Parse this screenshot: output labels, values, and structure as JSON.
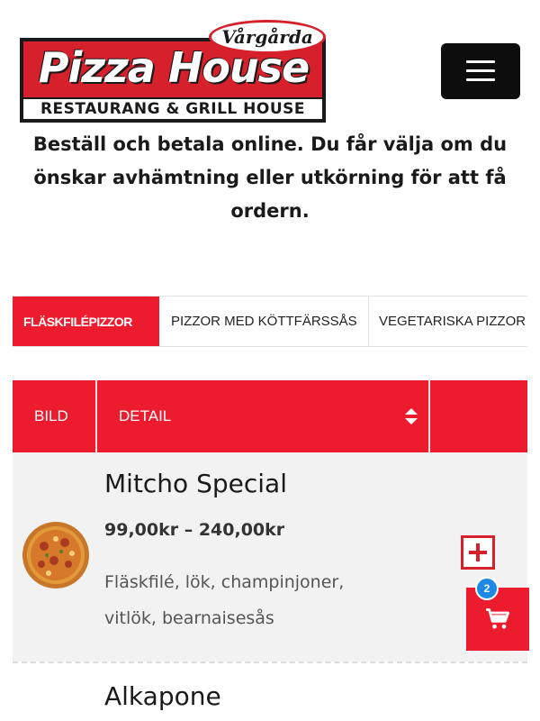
{
  "logo": {
    "town": "Vårgårda",
    "name": "Pizza House",
    "tagline": "RESTAURANG & GRILL HOUSE"
  },
  "intro_text": "Beställ och betala online. Du får välja om du önskar avhämtning eller utkörning för att få ordern.",
  "tabs": [
    {
      "label": "FLÄSKFILÉPIZZOR",
      "active": true
    },
    {
      "label": "PIZZOR MED KÖTTFÄRSSÅS",
      "active": false
    },
    {
      "label": "VEGETARISKA PIZZOR",
      "active": false
    }
  ],
  "table": {
    "col_image": "BILD",
    "col_detail": "DETAIL"
  },
  "products": [
    {
      "name": "Mitcho Special",
      "price": "99,00kr – 240,00kr",
      "description": "Fläskfilé, lök, champinjoner, vitlök, bearnaisesås"
    },
    {
      "name": "Alkapone"
    }
  ],
  "cart": {
    "count": "2"
  },
  "colors": {
    "accent": "#ec1c2e",
    "badge": "#1e88e5",
    "row_bg": "#f2f2f2"
  }
}
